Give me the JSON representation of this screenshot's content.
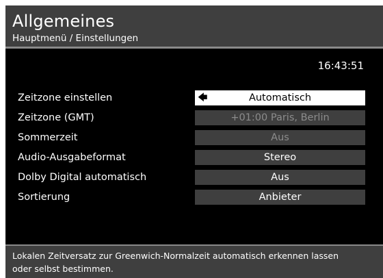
{
  "header": {
    "title": "Allgemeines",
    "breadcrumb": "Hauptmenü / Einstellungen"
  },
  "clock": "16:43:51",
  "settings": [
    {
      "label": "Zeitzone einstellen",
      "value": "Automatisch",
      "state": "selected"
    },
    {
      "label": "Zeitzone (GMT)",
      "value": "+01:00  Paris, Berlin",
      "state": "disabled"
    },
    {
      "label": "Sommerzeit",
      "value": "Aus",
      "state": "disabled"
    },
    {
      "label": "Audio-Ausgabeformat",
      "value": "Stereo",
      "state": "normal"
    },
    {
      "label": "Dolby Digital automatisch",
      "value": "Aus",
      "state": "normal"
    },
    {
      "label": "Sortierung",
      "value": "Anbieter",
      "state": "normal"
    }
  ],
  "help_text": "Lokalen Zeitversatz zur Greenwich-Normalzeit automatisch erkennen lassen oder selbst bestimmen.",
  "colors": {
    "background": "#000000",
    "panel": "#3f3f3f",
    "selected": "#ffffff",
    "disabled_text": "#8c8c8c"
  },
  "icons": {
    "selection_arrow": "arrow-left-icon"
  }
}
